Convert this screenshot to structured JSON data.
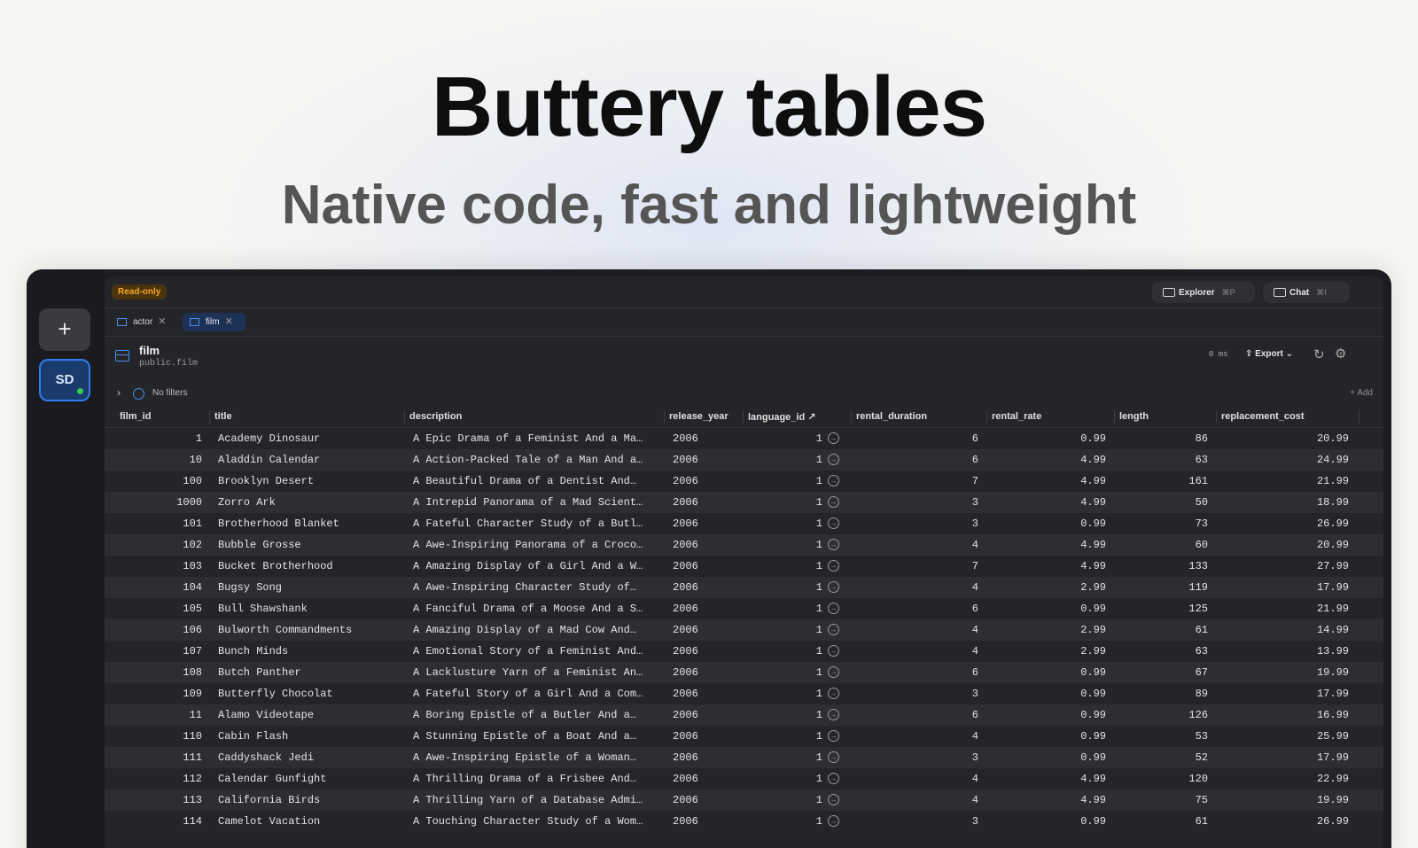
{
  "hero": {
    "title": "Buttery tables",
    "subtitle": "Native code, fast and lightweight"
  },
  "rail": {
    "add_label": "+",
    "connection_initials": "SD",
    "connection_status_color": "#2ecc55"
  },
  "topbar": {
    "badge": "Read-only",
    "explorer_label": "Explorer",
    "explorer_shortcut": "⌘P",
    "chat_label": "Chat",
    "chat_shortcut": "⌘I"
  },
  "tabs": [
    {
      "label": "actor",
      "active": false
    },
    {
      "label": "film",
      "active": true
    }
  ],
  "table": {
    "name": "film",
    "schema": "public.film",
    "query_time": "0 ms",
    "export_label": "Export",
    "export_chevron": "⌄"
  },
  "filters": {
    "label": "No filters",
    "add_label": "Add"
  },
  "columns": [
    "film_id",
    "title",
    "description",
    "release_year",
    "language_id",
    "rental_duration",
    "rental_rate",
    "length",
    "replacement_cost"
  ],
  "rows": [
    [
      "1",
      "Academy Dinosaur",
      "A Epic Drama of a Feminist And a Ma…",
      "2006",
      "1",
      "6",
      "0.99",
      "86",
      "20.99"
    ],
    [
      "10",
      "Aladdin Calendar",
      "A Action-Packed Tale of a Man And a…",
      "2006",
      "1",
      "6",
      "4.99",
      "63",
      "24.99"
    ],
    [
      "100",
      "Brooklyn Desert",
      "A Beautiful Drama of a Dentist And…",
      "2006",
      "1",
      "7",
      "4.99",
      "161",
      "21.99"
    ],
    [
      "1000",
      "Zorro Ark",
      "A Intrepid Panorama of a Mad Scient…",
      "2006",
      "1",
      "3",
      "4.99",
      "50",
      "18.99"
    ],
    [
      "101",
      "Brotherhood Blanket",
      "A Fateful Character Study of a Butl…",
      "2006",
      "1",
      "3",
      "0.99",
      "73",
      "26.99"
    ],
    [
      "102",
      "Bubble Grosse",
      "A Awe-Inspiring Panorama of a Croco…",
      "2006",
      "1",
      "4",
      "4.99",
      "60",
      "20.99"
    ],
    [
      "103",
      "Bucket Brotherhood",
      "A Amazing Display of a Girl And a W…",
      "2006",
      "1",
      "7",
      "4.99",
      "133",
      "27.99"
    ],
    [
      "104",
      "Bugsy Song",
      "A Awe-Inspiring Character Study of…",
      "2006",
      "1",
      "4",
      "2.99",
      "119",
      "17.99"
    ],
    [
      "105",
      "Bull Shawshank",
      "A Fanciful Drama of a Moose And a S…",
      "2006",
      "1",
      "6",
      "0.99",
      "125",
      "21.99"
    ],
    [
      "106",
      "Bulworth Commandments",
      "A Amazing Display of a Mad Cow And…",
      "2006",
      "1",
      "4",
      "2.99",
      "61",
      "14.99"
    ],
    [
      "107",
      "Bunch Minds",
      "A Emotional Story of a Feminist And…",
      "2006",
      "1",
      "4",
      "2.99",
      "63",
      "13.99"
    ],
    [
      "108",
      "Butch Panther",
      "A Lacklusture Yarn of a Feminist An…",
      "2006",
      "1",
      "6",
      "0.99",
      "67",
      "19.99"
    ],
    [
      "109",
      "Butterfly Chocolat",
      "A Fateful Story of a Girl And a Com…",
      "2006",
      "1",
      "3",
      "0.99",
      "89",
      "17.99"
    ],
    [
      "11",
      "Alamo Videotape",
      "A Boring Epistle of a Butler And a…",
      "2006",
      "1",
      "6",
      "0.99",
      "126",
      "16.99"
    ],
    [
      "110",
      "Cabin Flash",
      "A Stunning Epistle of a Boat And a…",
      "2006",
      "1",
      "4",
      "0.99",
      "53",
      "25.99"
    ],
    [
      "111",
      "Caddyshack Jedi",
      "A Awe-Inspiring Epistle of a Woman…",
      "2006",
      "1",
      "3",
      "0.99",
      "52",
      "17.99"
    ],
    [
      "112",
      "Calendar Gunfight",
      "A Thrilling Drama of a Frisbee And…",
      "2006",
      "1",
      "4",
      "4.99",
      "120",
      "22.99"
    ],
    [
      "113",
      "California Birds",
      "A Thrilling Yarn of a Database Admi…",
      "2006",
      "1",
      "4",
      "4.99",
      "75",
      "19.99"
    ],
    [
      "114",
      "Camelot Vacation",
      "A Touching Character Study of a Wom…",
      "2006",
      "1",
      "3",
      "0.99",
      "61",
      "26.99"
    ]
  ]
}
